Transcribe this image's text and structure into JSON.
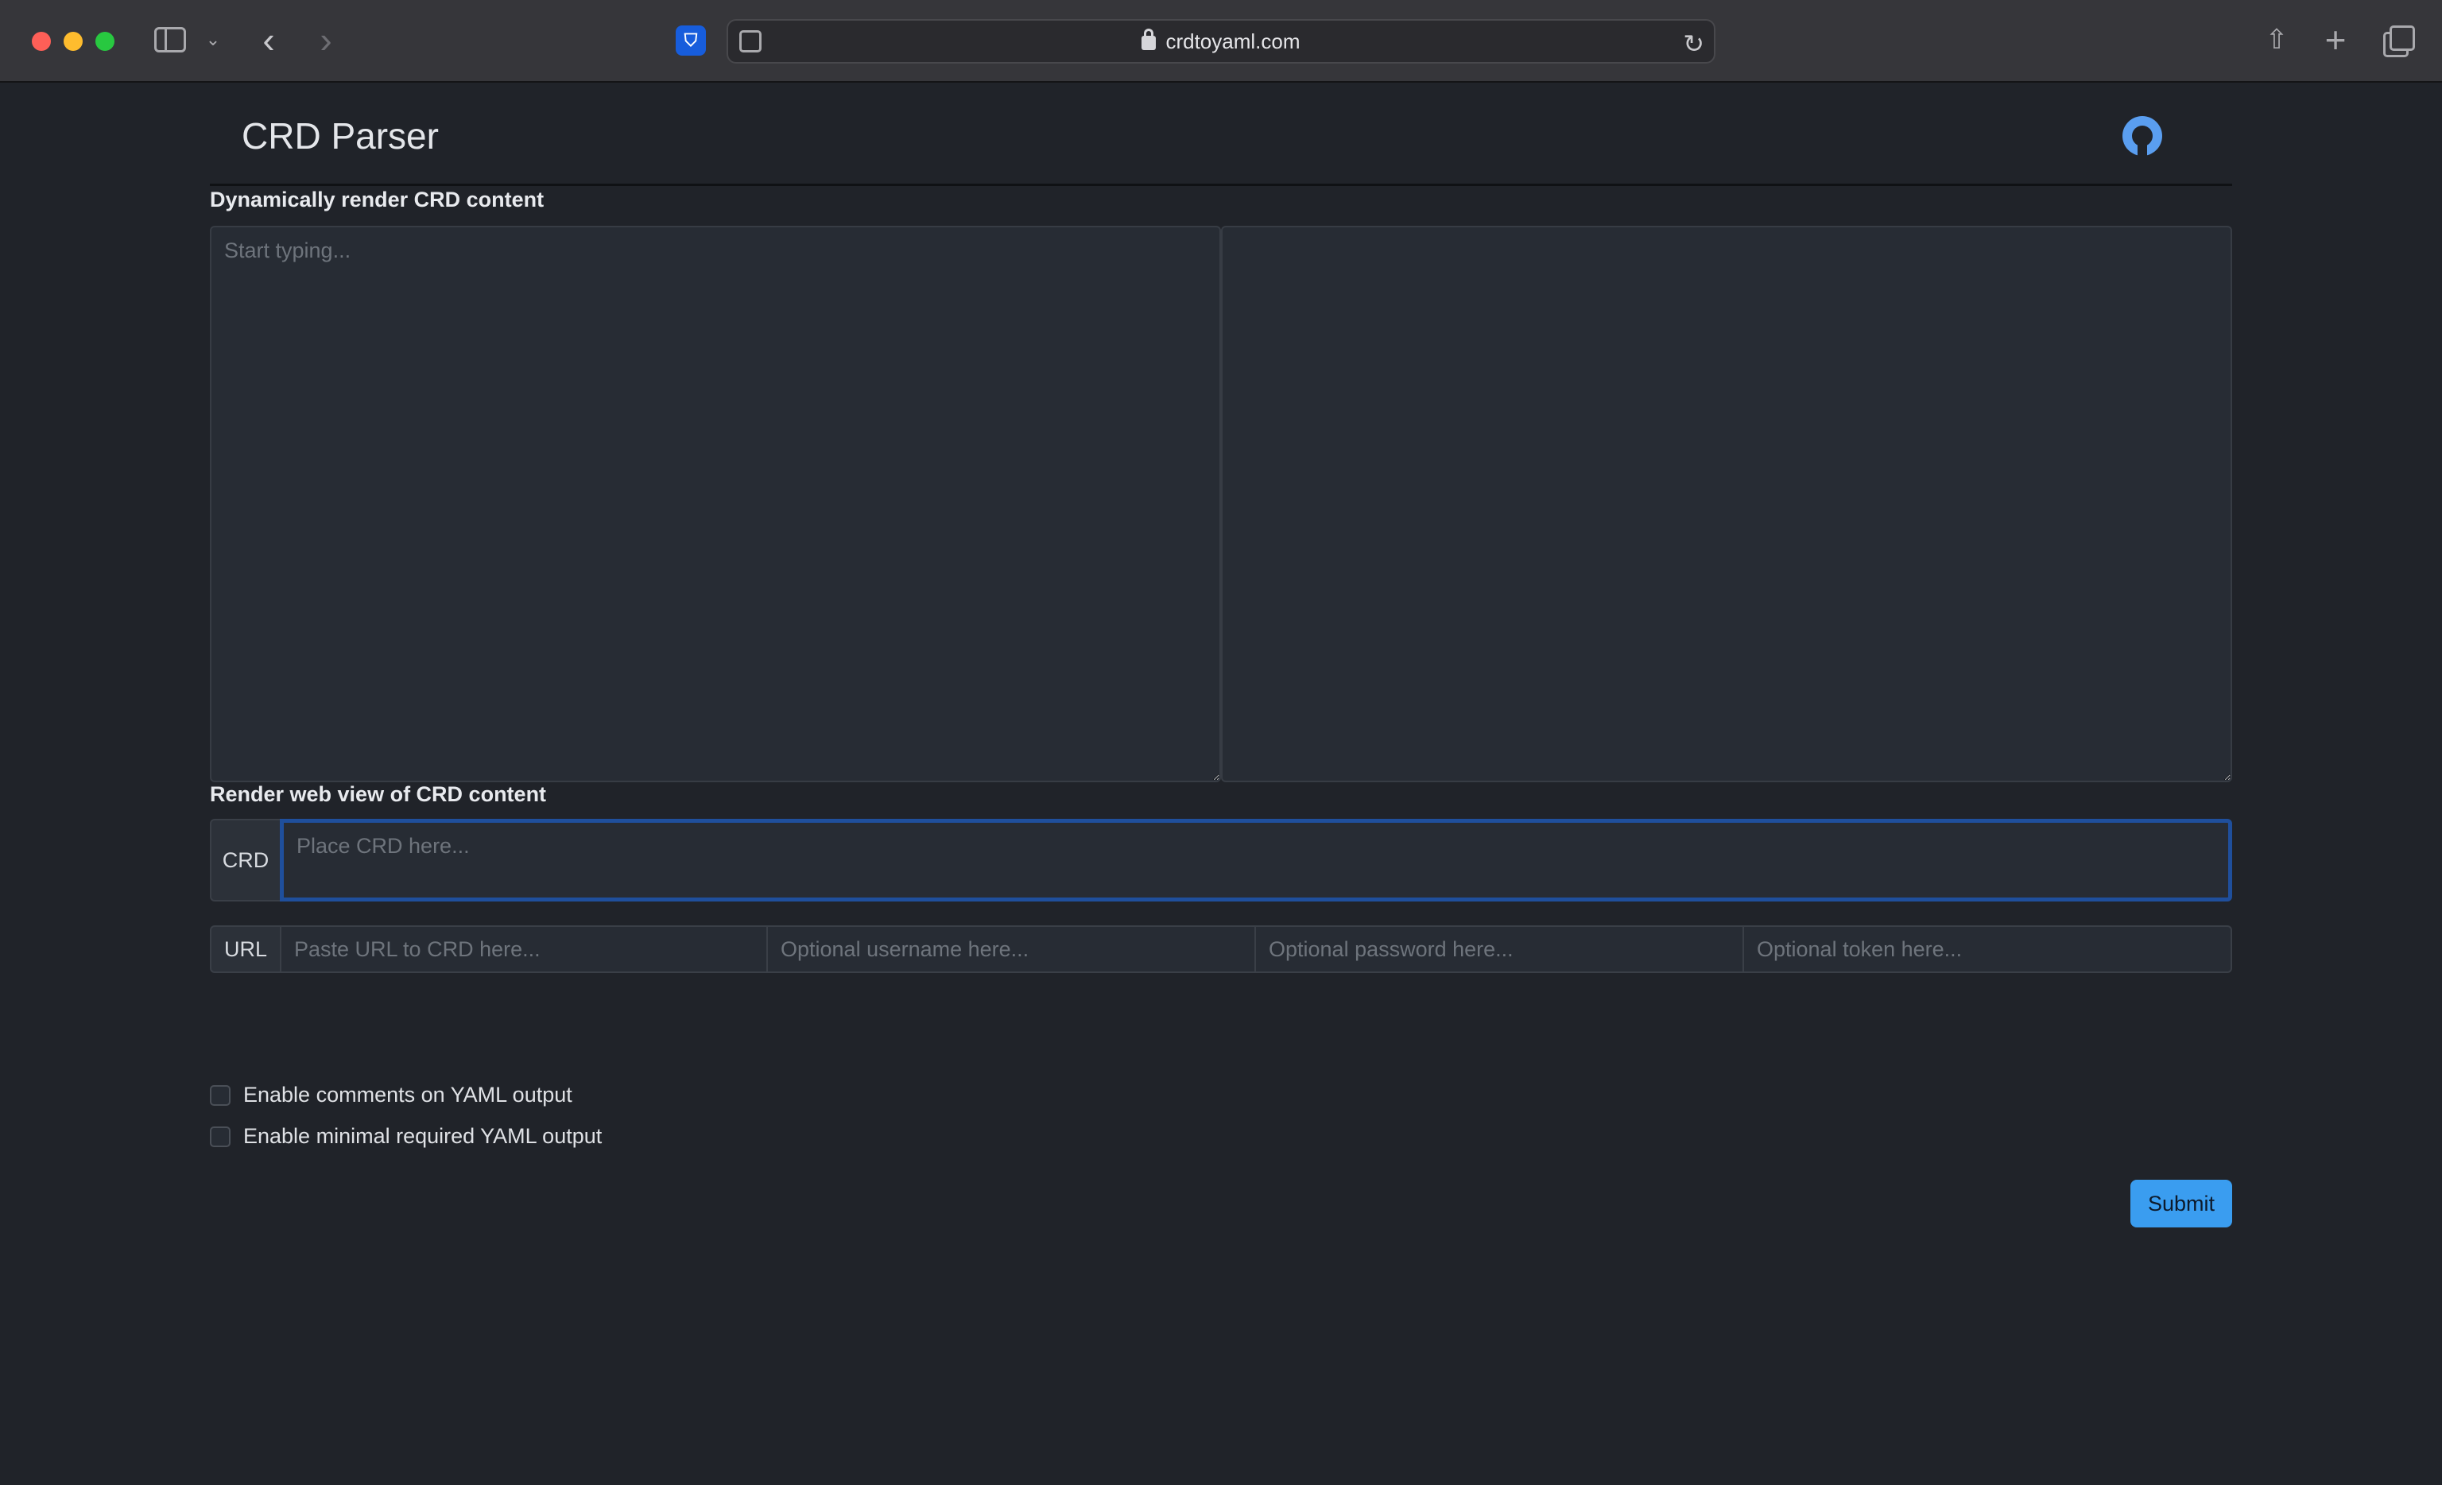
{
  "browser": {
    "url": "crdtoyaml.com",
    "icons": [
      "sidebar-icon",
      "chevron-down-icon",
      "back-icon",
      "forward-icon",
      "bitwarden-icon",
      "reader-icon",
      "lock-icon",
      "reload-icon",
      "share-icon",
      "plus-icon",
      "tabs-icon"
    ]
  },
  "header": {
    "title": "CRD Parser",
    "github_icon": "github-icon"
  },
  "dynamic": {
    "label": "Dynamically render CRD content",
    "input_placeholder": "Start typing...",
    "input_value": "",
    "output_value": ""
  },
  "web": {
    "label": "Render web view of CRD content",
    "crd_addon": "CRD",
    "crd_placeholder": "Place CRD here...",
    "url_addon": "URL",
    "url_placeholder": "Paste URL to CRD here...",
    "username_placeholder": "Optional username here...",
    "password_placeholder": "Optional password here...",
    "token_placeholder": "Optional token here..."
  },
  "options": {
    "comments_label": "Enable comments on YAML output",
    "comments_checked": false,
    "minimal_label": "Enable minimal required YAML output",
    "minimal_checked": false
  },
  "actions": {
    "submit_label": "Submit",
    "submit_color": "#3a9df0"
  }
}
